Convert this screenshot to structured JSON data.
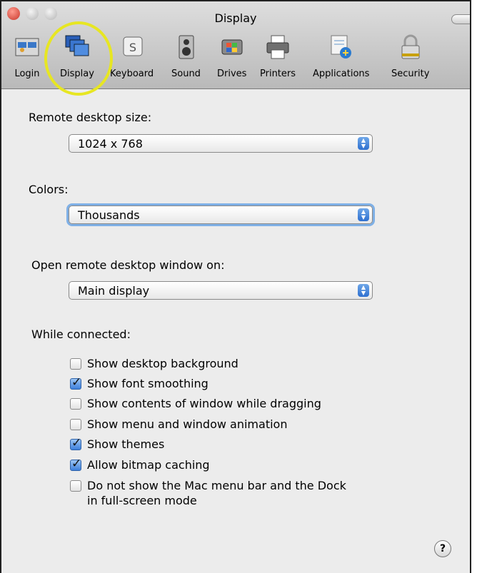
{
  "window": {
    "title": "Display"
  },
  "toolbar": {
    "items": [
      {
        "label": "Login",
        "icon": "login-icon"
      },
      {
        "label": "Display",
        "icon": "display-icon"
      },
      {
        "label": "Keyboard",
        "icon": "keyboard-icon"
      },
      {
        "label": "Sound",
        "icon": "sound-icon"
      },
      {
        "label": "Drives",
        "icon": "drives-icon"
      },
      {
        "label": "Printers",
        "icon": "printers-icon"
      },
      {
        "label": "Applications",
        "icon": "applications-icon"
      },
      {
        "label": "Security",
        "icon": "security-icon"
      }
    ],
    "selected": "Display"
  },
  "remote_size": {
    "label": "Remote desktop size:",
    "value": "1024 x 768"
  },
  "colors": {
    "label": "Colors:",
    "value": "Thousands"
  },
  "open_on": {
    "label": "Open remote desktop window on:",
    "value": "Main display"
  },
  "connected": {
    "label": "While connected:",
    "options": [
      {
        "text": "Show desktop background",
        "checked": false
      },
      {
        "text": "Show font smoothing",
        "checked": true
      },
      {
        "text": "Show contents of window while dragging",
        "checked": false
      },
      {
        "text": "Show menu and window animation",
        "checked": false
      },
      {
        "text": "Show themes",
        "checked": true
      },
      {
        "text": "Allow bitmap caching",
        "checked": true
      },
      {
        "text": "Do not show the Mac menu bar and the Dock",
        "text2": "in full-screen mode",
        "checked": false
      }
    ]
  },
  "help": {
    "glyph": "?"
  },
  "colors_accent": {
    "highlight": "#e7e622",
    "focus": "#7fb0e6",
    "checkbox": "#3d80dc"
  }
}
